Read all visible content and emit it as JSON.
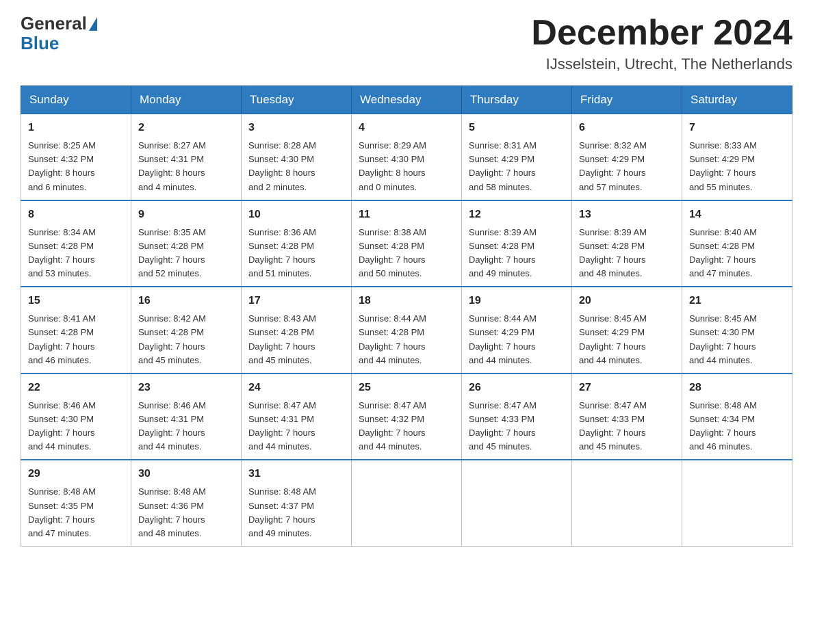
{
  "header": {
    "logo": {
      "general": "General",
      "blue": "Blue"
    },
    "title": "December 2024",
    "location": "IJsselstein, Utrecht, The Netherlands"
  },
  "weekdays": [
    "Sunday",
    "Monday",
    "Tuesday",
    "Wednesday",
    "Thursday",
    "Friday",
    "Saturday"
  ],
  "weeks": [
    [
      {
        "day": "1",
        "sunrise": "8:25 AM",
        "sunset": "4:32 PM",
        "daylight": "8 hours and 6 minutes."
      },
      {
        "day": "2",
        "sunrise": "8:27 AM",
        "sunset": "4:31 PM",
        "daylight": "8 hours and 4 minutes."
      },
      {
        "day": "3",
        "sunrise": "8:28 AM",
        "sunset": "4:30 PM",
        "daylight": "8 hours and 2 minutes."
      },
      {
        "day": "4",
        "sunrise": "8:29 AM",
        "sunset": "4:30 PM",
        "daylight": "8 hours and 0 minutes."
      },
      {
        "day": "5",
        "sunrise": "8:31 AM",
        "sunset": "4:29 PM",
        "daylight": "7 hours and 58 minutes."
      },
      {
        "day": "6",
        "sunrise": "8:32 AM",
        "sunset": "4:29 PM",
        "daylight": "7 hours and 57 minutes."
      },
      {
        "day": "7",
        "sunrise": "8:33 AM",
        "sunset": "4:29 PM",
        "daylight": "7 hours and 55 minutes."
      }
    ],
    [
      {
        "day": "8",
        "sunrise": "8:34 AM",
        "sunset": "4:28 PM",
        "daylight": "7 hours and 53 minutes."
      },
      {
        "day": "9",
        "sunrise": "8:35 AM",
        "sunset": "4:28 PM",
        "daylight": "7 hours and 52 minutes."
      },
      {
        "day": "10",
        "sunrise": "8:36 AM",
        "sunset": "4:28 PM",
        "daylight": "7 hours and 51 minutes."
      },
      {
        "day": "11",
        "sunrise": "8:38 AM",
        "sunset": "4:28 PM",
        "daylight": "7 hours and 50 minutes."
      },
      {
        "day": "12",
        "sunrise": "8:39 AM",
        "sunset": "4:28 PM",
        "daylight": "7 hours and 49 minutes."
      },
      {
        "day": "13",
        "sunrise": "8:39 AM",
        "sunset": "4:28 PM",
        "daylight": "7 hours and 48 minutes."
      },
      {
        "day": "14",
        "sunrise": "8:40 AM",
        "sunset": "4:28 PM",
        "daylight": "7 hours and 47 minutes."
      }
    ],
    [
      {
        "day": "15",
        "sunrise": "8:41 AM",
        "sunset": "4:28 PM",
        "daylight": "7 hours and 46 minutes."
      },
      {
        "day": "16",
        "sunrise": "8:42 AM",
        "sunset": "4:28 PM",
        "daylight": "7 hours and 45 minutes."
      },
      {
        "day": "17",
        "sunrise": "8:43 AM",
        "sunset": "4:28 PM",
        "daylight": "7 hours and 45 minutes."
      },
      {
        "day": "18",
        "sunrise": "8:44 AM",
        "sunset": "4:28 PM",
        "daylight": "7 hours and 44 minutes."
      },
      {
        "day": "19",
        "sunrise": "8:44 AM",
        "sunset": "4:29 PM",
        "daylight": "7 hours and 44 minutes."
      },
      {
        "day": "20",
        "sunrise": "8:45 AM",
        "sunset": "4:29 PM",
        "daylight": "7 hours and 44 minutes."
      },
      {
        "day": "21",
        "sunrise": "8:45 AM",
        "sunset": "4:30 PM",
        "daylight": "7 hours and 44 minutes."
      }
    ],
    [
      {
        "day": "22",
        "sunrise": "8:46 AM",
        "sunset": "4:30 PM",
        "daylight": "7 hours and 44 minutes."
      },
      {
        "day": "23",
        "sunrise": "8:46 AM",
        "sunset": "4:31 PM",
        "daylight": "7 hours and 44 minutes."
      },
      {
        "day": "24",
        "sunrise": "8:47 AM",
        "sunset": "4:31 PM",
        "daylight": "7 hours and 44 minutes."
      },
      {
        "day": "25",
        "sunrise": "8:47 AM",
        "sunset": "4:32 PM",
        "daylight": "7 hours and 44 minutes."
      },
      {
        "day": "26",
        "sunrise": "8:47 AM",
        "sunset": "4:33 PM",
        "daylight": "7 hours and 45 minutes."
      },
      {
        "day": "27",
        "sunrise": "8:47 AM",
        "sunset": "4:33 PM",
        "daylight": "7 hours and 45 minutes."
      },
      {
        "day": "28",
        "sunrise": "8:48 AM",
        "sunset": "4:34 PM",
        "daylight": "7 hours and 46 minutes."
      }
    ],
    [
      {
        "day": "29",
        "sunrise": "8:48 AM",
        "sunset": "4:35 PM",
        "daylight": "7 hours and 47 minutes."
      },
      {
        "day": "30",
        "sunrise": "8:48 AM",
        "sunset": "4:36 PM",
        "daylight": "7 hours and 48 minutes."
      },
      {
        "day": "31",
        "sunrise": "8:48 AM",
        "sunset": "4:37 PM",
        "daylight": "7 hours and 49 minutes."
      },
      null,
      null,
      null,
      null
    ]
  ]
}
